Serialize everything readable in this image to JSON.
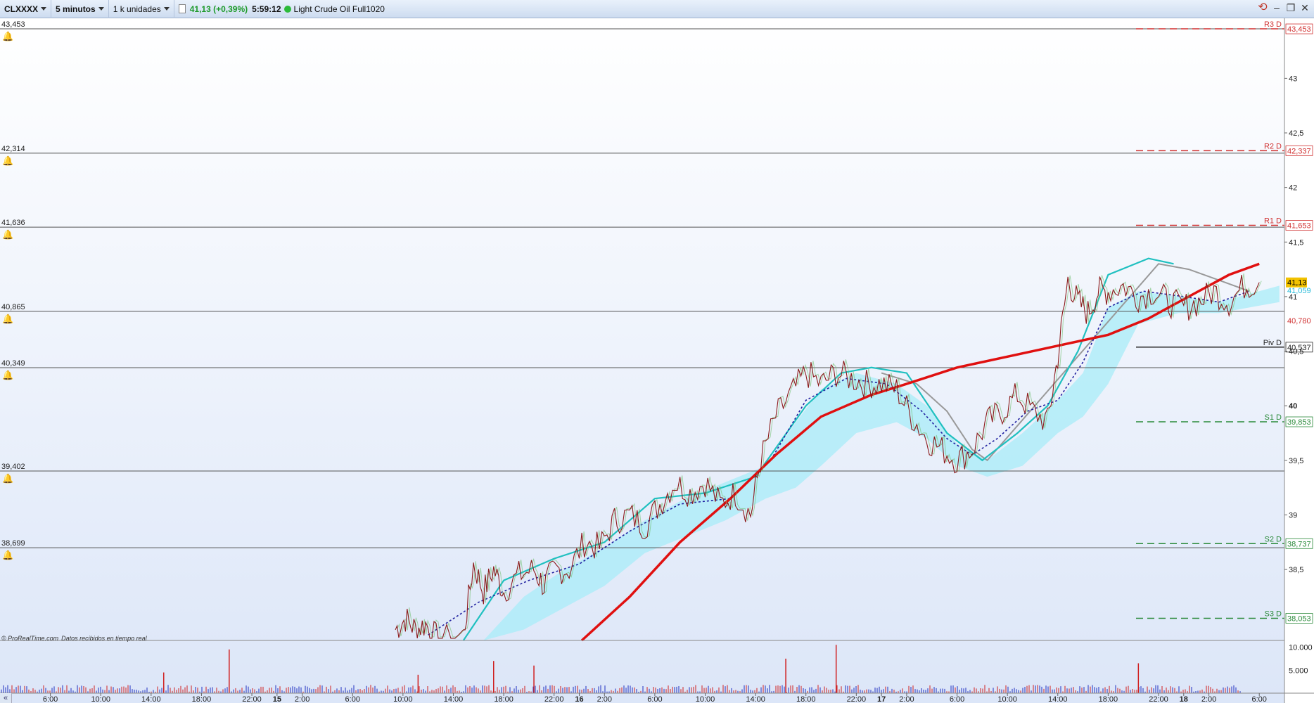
{
  "toolbar": {
    "symbol": "CLXXXX",
    "timeframe": "5 minutos",
    "units": "1 k unidades",
    "quote": "41,13 (+0,39%)",
    "time": "5:59:12",
    "instrument": "Light Crude Oil Full1020"
  },
  "footer": {
    "brand": "© ProRealTime.com",
    "realtime": "Datos recibidos en tiempo real"
  },
  "colors": {
    "background_top": "#ffffff",
    "background_bottom": "#dce6f8",
    "price_line": "#8b1a1a",
    "ma_red": "#e01010",
    "ma_cyan": "#20c0c0",
    "ma_gray": "#999999",
    "ma_blue_dotted": "#2020a0",
    "cloud": "#a8ecf8",
    "resistance": "#d03030",
    "support": "#2a8a3a",
    "pivot": "#222222"
  },
  "chart_data": {
    "type": "line",
    "y_axis": {
      "range": [
        37.85,
        43.55
      ],
      "ticks": [
        "43",
        "42,5",
        "42",
        "41,5",
        "41",
        "40,5",
        "40",
        "39,5",
        "39",
        "38,5"
      ]
    },
    "x_axis": {
      "range": [
        0,
        25.5
      ],
      "ticks": [
        {
          "x": 1,
          "label": "6:00"
        },
        {
          "x": 2,
          "label": "10:00"
        },
        {
          "x": 3,
          "label": "14:00"
        },
        {
          "x": 4,
          "label": "18:00"
        },
        {
          "x": 5,
          "label": "22:00"
        },
        {
          "x": 5.5,
          "label": "15",
          "bold": true
        },
        {
          "x": 6,
          "label": "2:00"
        },
        {
          "x": 7,
          "label": "6:00"
        },
        {
          "x": 8,
          "label": "10:00"
        },
        {
          "x": 9,
          "label": "14:00"
        },
        {
          "x": 10,
          "label": "18:00"
        },
        {
          "x": 11,
          "label": "22:00"
        },
        {
          "x": 11.5,
          "label": "16",
          "bold": true
        },
        {
          "x": 12,
          "label": "2:00"
        },
        {
          "x": 13,
          "label": "6:00"
        },
        {
          "x": 14,
          "label": "10:00"
        },
        {
          "x": 15,
          "label": "14:00"
        },
        {
          "x": 16,
          "label": "18:00"
        },
        {
          "x": 17,
          "label": "22:00"
        },
        {
          "x": 17.5,
          "label": "17",
          "bold": true
        },
        {
          "x": 18,
          "label": "2:00"
        },
        {
          "x": 19,
          "label": "6:00"
        },
        {
          "x": 20,
          "label": "10:00"
        },
        {
          "x": 21,
          "label": "14:00"
        },
        {
          "x": 22,
          "label": "18:00"
        },
        {
          "x": 23,
          "label": "22:00"
        },
        {
          "x": 23.5,
          "label": "18",
          "bold": true
        },
        {
          "x": 24,
          "label": "2:00"
        },
        {
          "x": 25,
          "label": "6:00"
        }
      ]
    },
    "alert_lines": [
      {
        "value": 43.453,
        "label": "43,453"
      },
      {
        "value": 42.314,
        "label": "42,314"
      },
      {
        "value": 41.636,
        "label": "41,636"
      },
      {
        "value": 40.865,
        "label": "40,865"
      },
      {
        "value": 40.349,
        "label": "40,349"
      },
      {
        "value": 39.402,
        "label": "39,402"
      },
      {
        "value": 38.699,
        "label": "38,699"
      }
    ],
    "pivot_levels": [
      {
        "name": "R3 D",
        "value": 43.453,
        "label": "43,453",
        "kind": "resistance"
      },
      {
        "name": "R2 D",
        "value": 42.337,
        "label": "42,337",
        "kind": "resistance"
      },
      {
        "name": "R1 D",
        "value": 41.653,
        "label": "41,653",
        "kind": "resistance"
      },
      {
        "name": "Piv D",
        "value": 40.537,
        "label": "40,537",
        "kind": "pivot"
      },
      {
        "name": "S1 D",
        "value": 39.853,
        "label": "39,853",
        "kind": "support"
      },
      {
        "name": "S2 D",
        "value": 38.737,
        "label": "38,737",
        "kind": "support"
      },
      {
        "name": "S3 D",
        "value": 38.053,
        "label": "38,053",
        "kind": "support"
      }
    ],
    "current_price": {
      "value": 41.13,
      "label": "41,13"
    },
    "axis_markers": [
      {
        "value": 41.059,
        "label": "41,059",
        "color": "#20b8d8"
      },
      {
        "value": 40.78,
        "label": "40,780",
        "color": "#d03030"
      }
    ],
    "price_series": [
      [
        7.85,
        37.95
      ],
      [
        8.05,
        38.05
      ],
      [
        8.25,
        37.95
      ],
      [
        8.45,
        38.0
      ],
      [
        8.7,
        37.85
      ],
      [
        9.2,
        37.9
      ],
      [
        9.4,
        38.55
      ],
      [
        9.6,
        38.3
      ],
      [
        9.8,
        38.5
      ],
      [
        10.0,
        38.3
      ],
      [
        10.3,
        38.45
      ],
      [
        10.6,
        38.5
      ],
      [
        10.8,
        38.35
      ],
      [
        11.0,
        38.5
      ],
      [
        11.3,
        38.5
      ],
      [
        11.6,
        38.75
      ],
      [
        11.9,
        38.7
      ],
      [
        12.2,
        38.95
      ],
      [
        12.5,
        39.0
      ],
      [
        12.8,
        38.9
      ],
      [
        13.1,
        39.1
      ],
      [
        13.4,
        39.3
      ],
      [
        13.7,
        39.2
      ],
      [
        14.0,
        39.3
      ],
      [
        14.3,
        39.1
      ],
      [
        14.6,
        39.2
      ],
      [
        14.9,
        39.0
      ],
      [
        15.1,
        39.5
      ],
      [
        15.4,
        39.9
      ],
      [
        15.7,
        40.1
      ],
      [
        16.0,
        40.3
      ],
      [
        16.3,
        40.2
      ],
      [
        16.6,
        40.3
      ],
      [
        16.9,
        40.25
      ],
      [
        17.2,
        40.2
      ],
      [
        17.5,
        40.2
      ],
      [
        17.8,
        40.15
      ],
      [
        18.1,
        39.9
      ],
      [
        18.4,
        39.7
      ],
      [
        18.7,
        39.6
      ],
      [
        19.0,
        39.5
      ],
      [
        19.3,
        39.6
      ],
      [
        19.6,
        39.85
      ],
      [
        19.9,
        39.95
      ],
      [
        20.2,
        40.1
      ],
      [
        20.5,
        39.95
      ],
      [
        20.8,
        39.85
      ],
      [
        21.0,
        40.45
      ],
      [
        21.2,
        41.15
      ],
      [
        21.4,
        40.95
      ],
      [
        21.6,
        40.85
      ],
      [
        21.8,
        41.05
      ],
      [
        22.0,
        41.05
      ],
      [
        22.3,
        41.1
      ],
      [
        22.6,
        41.0
      ],
      [
        22.9,
        41.05
      ],
      [
        23.2,
        40.95
      ],
      [
        23.5,
        40.9
      ],
      [
        23.8,
        40.95
      ],
      [
        24.1,
        41.05
      ],
      [
        24.4,
        40.95
      ],
      [
        24.7,
        41.1
      ],
      [
        25.0,
        41.13
      ]
    ],
    "ma_red": [
      [
        11.55,
        37.85
      ],
      [
        12.5,
        38.25
      ],
      [
        13.5,
        38.75
      ],
      [
        14.5,
        39.15
      ],
      [
        15.4,
        39.55
      ],
      [
        16.3,
        39.9
      ],
      [
        17.3,
        40.1
      ],
      [
        18.0,
        40.2
      ],
      [
        19.0,
        40.35
      ],
      [
        20.0,
        40.45
      ],
      [
        21.0,
        40.55
      ],
      [
        22.0,
        40.65
      ],
      [
        22.8,
        40.8
      ],
      [
        23.6,
        41.0
      ],
      [
        24.4,
        41.2
      ],
      [
        25.0,
        41.3
      ]
    ],
    "ma_cyan": [
      [
        9.2,
        37.85
      ],
      [
        10.0,
        38.4
      ],
      [
        11.0,
        38.6
      ],
      [
        12.0,
        38.75
      ],
      [
        13.0,
        39.15
      ],
      [
        14.0,
        39.2
      ],
      [
        15.0,
        39.35
      ],
      [
        16.0,
        40.0
      ],
      [
        16.7,
        40.3
      ],
      [
        17.3,
        40.35
      ],
      [
        18.0,
        40.3
      ],
      [
        18.8,
        39.75
      ],
      [
        19.5,
        39.5
      ],
      [
        20.2,
        39.75
      ],
      [
        20.8,
        40.0
      ],
      [
        21.4,
        40.5
      ],
      [
        22.0,
        41.2
      ],
      [
        22.8,
        41.35
      ],
      [
        23.3,
        41.3
      ]
    ],
    "ma_gray": [
      [
        17.5,
        40.3
      ],
      [
        18.2,
        40.2
      ],
      [
        18.8,
        39.95
      ],
      [
        19.3,
        39.6
      ],
      [
        19.6,
        39.5
      ],
      [
        23.0,
        41.3
      ],
      [
        23.6,
        41.25
      ],
      [
        24.2,
        41.15
      ],
      [
        24.8,
        41.05
      ]
    ],
    "ma_blue": [
      [
        8.5,
        37.9
      ],
      [
        9.5,
        38.2
      ],
      [
        10.5,
        38.4
      ],
      [
        11.5,
        38.55
      ],
      [
        12.5,
        38.85
      ],
      [
        13.5,
        39.1
      ],
      [
        14.5,
        39.15
      ],
      [
        15.3,
        39.5
      ],
      [
        16.0,
        40.05
      ],
      [
        16.8,
        40.25
      ],
      [
        17.6,
        40.2
      ],
      [
        18.3,
        39.95
      ],
      [
        18.8,
        39.7
      ],
      [
        19.3,
        39.55
      ],
      [
        19.8,
        39.7
      ],
      [
        20.4,
        39.95
      ],
      [
        21.0,
        40.05
      ],
      [
        21.5,
        40.4
      ],
      [
        22.0,
        40.9
      ],
      [
        22.7,
        41.05
      ],
      [
        23.5,
        41.0
      ],
      [
        24.2,
        40.95
      ],
      [
        24.8,
        41.05
      ]
    ],
    "cloud_upper": [
      [
        9.6,
        37.85
      ],
      [
        10.4,
        38.25
      ],
      [
        11.2,
        38.5
      ],
      [
        12.0,
        38.7
      ],
      [
        12.8,
        38.95
      ],
      [
        13.6,
        39.15
      ],
      [
        14.4,
        39.3
      ],
      [
        15.2,
        39.45
      ],
      [
        15.8,
        39.85
      ],
      [
        16.3,
        40.15
      ],
      [
        17.0,
        40.3
      ],
      [
        17.8,
        40.2
      ],
      [
        18.4,
        40.0
      ],
      [
        19.0,
        39.65
      ],
      [
        19.6,
        39.5
      ],
      [
        20.3,
        39.75
      ],
      [
        21.0,
        40.05
      ],
      [
        21.5,
        40.3
      ],
      [
        22.0,
        40.9
      ],
      [
        22.6,
        41.05
      ],
      [
        23.4,
        41.0
      ],
      [
        24.2,
        40.95
      ],
      [
        25.4,
        41.1
      ]
    ],
    "cloud_lower": [
      [
        25.4,
        40.95
      ],
      [
        24.2,
        40.85
      ],
      [
        23.4,
        40.85
      ],
      [
        22.6,
        40.75
      ],
      [
        22.0,
        40.2
      ],
      [
        21.5,
        39.9
      ],
      [
        21.0,
        39.75
      ],
      [
        20.3,
        39.45
      ],
      [
        19.6,
        39.35
      ],
      [
        19.0,
        39.45
      ],
      [
        18.4,
        39.7
      ],
      [
        17.8,
        39.85
      ],
      [
        17.0,
        39.75
      ],
      [
        16.3,
        39.45
      ],
      [
        15.8,
        39.25
      ],
      [
        15.2,
        39.15
      ],
      [
        14.4,
        38.95
      ],
      [
        13.6,
        38.8
      ],
      [
        12.8,
        38.65
      ],
      [
        12.0,
        38.35
      ],
      [
        11.2,
        38.15
      ],
      [
        10.4,
        37.95
      ],
      [
        9.6,
        37.85
      ]
    ],
    "volume": {
      "ticks": [
        {
          "value": 10000,
          "label": "10.000"
        },
        {
          "value": 5000,
          "label": "5.000"
        }
      ],
      "max": 11000,
      "spikes": [
        {
          "x": 3.25,
          "v": 4500
        },
        {
          "x": 4.55,
          "v": 9500
        },
        {
          "x": 8.3,
          "v": 4000
        },
        {
          "x": 9.8,
          "v": 7000
        },
        {
          "x": 10.6,
          "v": 6000
        },
        {
          "x": 15.6,
          "v": 7500
        },
        {
          "x": 16.6,
          "v": 10500
        },
        {
          "x": 22.6,
          "v": 6500
        }
      ]
    }
  }
}
